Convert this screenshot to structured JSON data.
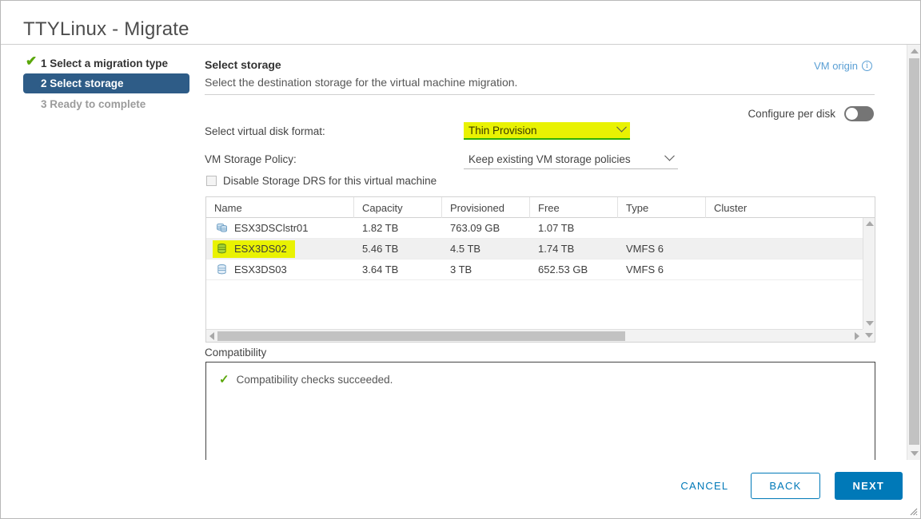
{
  "window": {
    "title": "TTYLinux - Migrate"
  },
  "steps": [
    {
      "num": "1",
      "label": "1 Select a migration type",
      "state": "done",
      "icon": "check-icon"
    },
    {
      "num": "2",
      "label": "2 Select storage",
      "state": "current"
    },
    {
      "num": "3",
      "label": "3 Ready to complete",
      "state": "pending"
    }
  ],
  "main": {
    "heading": "Select storage",
    "subheading": "Select the destination storage for the virtual machine migration.",
    "vm_origin_label": "VM origin",
    "vm_origin_icon": "info-icon",
    "configure_per_disk_label": "Configure per disk",
    "configure_per_disk_value": "off",
    "disk_format_label": "Select virtual disk format:",
    "disk_format_value": "Thin Provision",
    "storage_policy_label": "VM Storage Policy:",
    "storage_policy_value": "Keep existing VM storage policies",
    "disable_drs_label": "Disable Storage DRS for this virtual machine",
    "disable_drs_checked": false
  },
  "table": {
    "columns": [
      "Name",
      "Capacity",
      "Provisioned",
      "Free",
      "Type",
      "Cluster"
    ],
    "rows": [
      {
        "name": "ESX3DSClstr01",
        "icon": "datastore-cluster-icon",
        "capacity": "1.82 TB",
        "provisioned": "763.09 GB",
        "free": "1.07 TB",
        "type": "",
        "cluster": "",
        "selected": false,
        "highlighted": false
      },
      {
        "name": "ESX3DS02",
        "icon": "datastore-icon",
        "capacity": "5.46 TB",
        "provisioned": "4.5 TB",
        "free": "1.74 TB",
        "type": "VMFS 6",
        "cluster": "",
        "selected": true,
        "highlighted": true
      },
      {
        "name": "ESX3DS03",
        "icon": "datastore-icon",
        "capacity": "3.64 TB",
        "provisioned": "3 TB",
        "free": "652.53 GB",
        "type": "VMFS 6",
        "cluster": "",
        "selected": false,
        "highlighted": false
      }
    ]
  },
  "compatibility": {
    "label": "Compatibility",
    "status_icon": "check-icon",
    "status_text": "Compatibility checks succeeded."
  },
  "footer": {
    "cancel_label": "CANCEL",
    "back_label": "BACK",
    "next_label": "NEXT"
  },
  "colors": {
    "accent_blue": "#0079b8",
    "step_current_bg": "#2e5c87",
    "highlight_yellow": "#e9f202",
    "highlight_underline_green": "#2faf00",
    "success_green": "#5aa70a"
  }
}
